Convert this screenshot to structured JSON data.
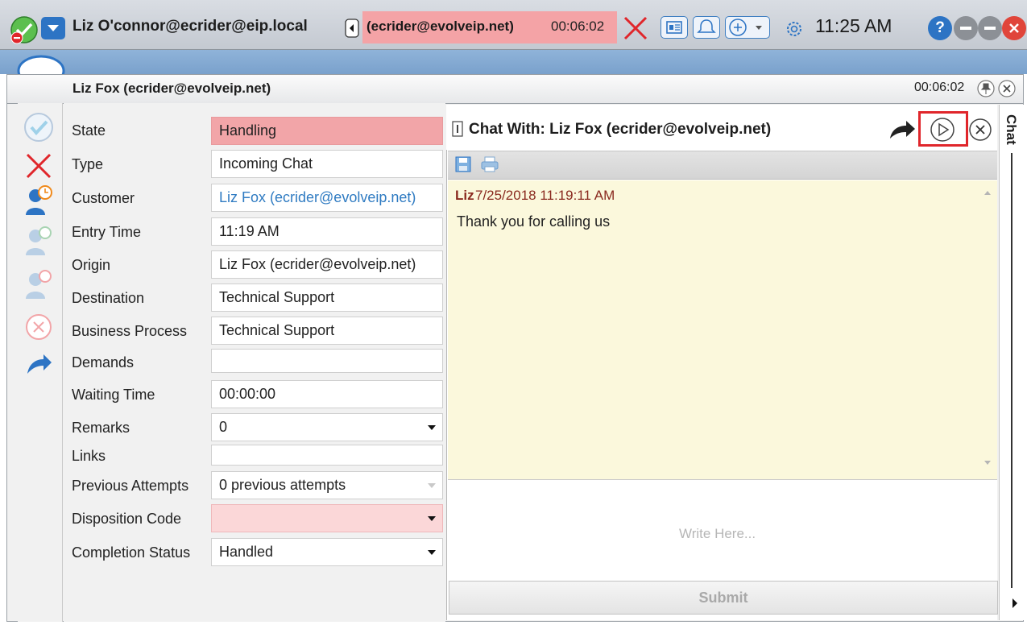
{
  "topbar": {
    "agent_name": "Liz O'connor@ecrider@eip.local",
    "active_interaction": "(ecrider@evolveip.net)",
    "active_timer": "00:06:02",
    "clock": "11:25 AM",
    "help_label": "?"
  },
  "window": {
    "title": "Liz Fox (ecrider@evolveip.net)",
    "timer": "00:06:02"
  },
  "form": {
    "rows": [
      {
        "label": "State",
        "value": "Handling"
      },
      {
        "label": "Type",
        "value": "Incoming Chat"
      },
      {
        "label": "Customer",
        "value": "Liz Fox (ecrider@evolveip.net)"
      },
      {
        "label": "Entry Time",
        "value": "11:19 AM"
      },
      {
        "label": "Origin",
        "value": "Liz Fox (ecrider@evolveip.net)"
      },
      {
        "label": "Destination",
        "value": "Technical Support"
      },
      {
        "label": "Business Process",
        "value": "Technical Support"
      },
      {
        "label": "Demands",
        "value": ""
      },
      {
        "label": "Waiting Time",
        "value": "00:00:00"
      },
      {
        "label": "Remarks",
        "value": "0"
      },
      {
        "label": "Links",
        "value": ""
      },
      {
        "label": "Previous Attempts",
        "value": "0 previous attempts"
      },
      {
        "label": "Disposition Code",
        "value": ""
      },
      {
        "label": "Completion Status",
        "value": "Handled"
      }
    ]
  },
  "chat": {
    "title": "Chat With: Liz Fox (ecrider@evolveip.net)",
    "messages": [
      {
        "author": "Liz",
        "time": "7/25/2018 11:19:11 AM",
        "text": "Thank you for calling us"
      }
    ],
    "compose_placeholder": "Write Here...",
    "submit_label": "Submit",
    "rail_label": "Chat"
  },
  "colors": {
    "state_handling": "#f2a5a8",
    "disposition_required": "#fbd7d8",
    "transcript_bg": "#fbf8dc",
    "highlight_box": "#e0262b",
    "accent_blue": "#2f7bc2"
  }
}
